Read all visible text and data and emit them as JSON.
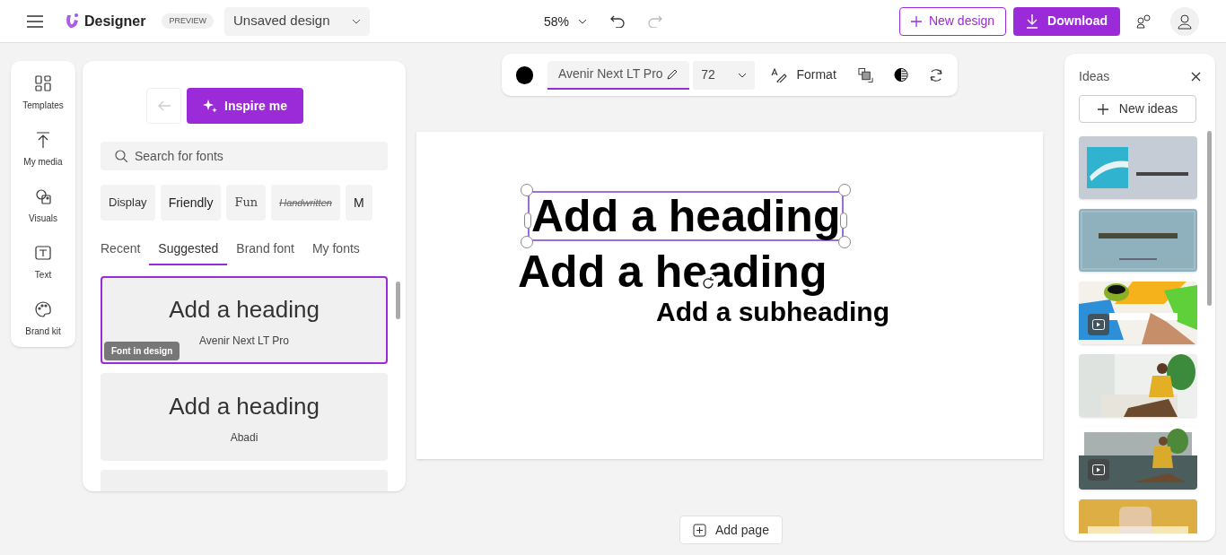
{
  "header": {
    "app_name": "Designer",
    "badge": "PREVIEW",
    "design_name": "Unsaved design",
    "zoom": "58%",
    "new_design": "New design",
    "download": "Download"
  },
  "rail": [
    {
      "label": "Templates"
    },
    {
      "label": "My media"
    },
    {
      "label": "Visuals"
    },
    {
      "label": "Text"
    },
    {
      "label": "Brand kit"
    }
  ],
  "font_panel": {
    "inspire": "Inspire me",
    "search": {
      "placeholder": "Search for fonts"
    },
    "chips": [
      "Display",
      "Friendly",
      "Fun",
      "Handwritten",
      "M"
    ],
    "tabs": [
      {
        "label": "Recent",
        "selected": false
      },
      {
        "label": "Suggested",
        "selected": true
      },
      {
        "label": "Brand font",
        "selected": false
      },
      {
        "label": "My fonts",
        "selected": false
      }
    ],
    "fonts": [
      {
        "sample": "Add a heading",
        "name": "Avenir Next LT Pro",
        "selected": true,
        "badge": "Font in design"
      },
      {
        "sample": "Add a heading",
        "name": "Abadi",
        "selected": false
      },
      {
        "selected": false
      }
    ]
  },
  "toolbar": {
    "color": "#000000",
    "font": "Avenir Next LT Pro",
    "size": "72",
    "format": "Format"
  },
  "canvas": {
    "texts": [
      {
        "text": "Add a heading",
        "kind": "heading",
        "selected": true
      },
      {
        "text": "Add a heading",
        "kind": "heading",
        "selected": false
      },
      {
        "text": "Add a subheading",
        "kind": "subheading",
        "selected": false
      }
    ],
    "add_page": "Add page"
  },
  "ideas": {
    "title": "Ideas",
    "new_ideas": "New ideas",
    "thumbnails": [
      {
        "kind": "picture",
        "video": false
      },
      {
        "kind": "picture",
        "video": false
      },
      {
        "kind": "picture",
        "video": true
      },
      {
        "kind": "picture",
        "video": false
      },
      {
        "kind": "picture",
        "video": true
      },
      {
        "kind": "picture",
        "video": false
      }
    ]
  }
}
